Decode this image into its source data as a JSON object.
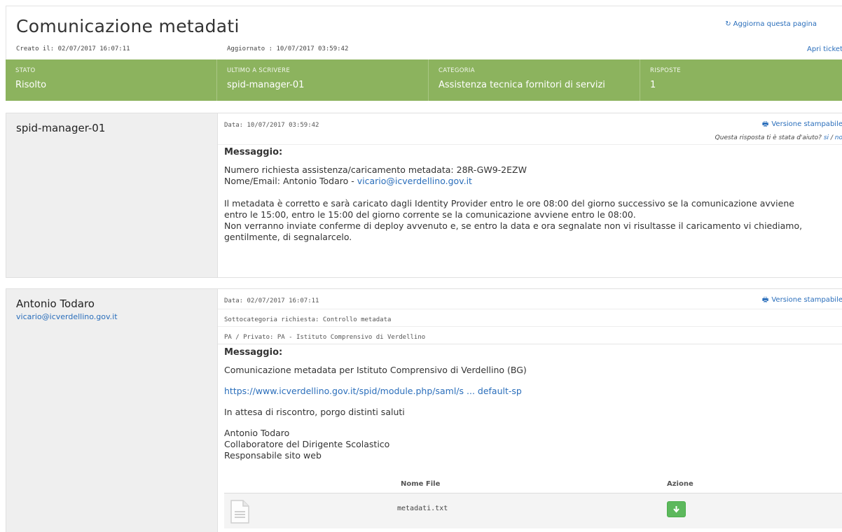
{
  "header": {
    "title": "Comunicazione metadati",
    "created": "Creato il: 02/07/2017 16:07:11",
    "updated": "Aggiornato : 10/07/2017 03:59:42",
    "refresh_label": "Aggiorna questa pagina",
    "open_ticket_label": "Apri ticket"
  },
  "status_bar": {
    "color": "#8cb35e",
    "cells": [
      {
        "label": "STATO",
        "value": "Risolto"
      },
      {
        "label": "ULTIMO A SCRIVERE",
        "value": "spid-manager-01"
      },
      {
        "label": "CATEGORIA",
        "value": "Assistenza tecnica fornitori di servizi"
      },
      {
        "label": "RISPOSTE",
        "value": "1"
      }
    ]
  },
  "messages": [
    {
      "author": "spid-manager-01",
      "date": "Data: 10/07/2017 03:59:42",
      "print_label": "Versione stampabile",
      "helpful_question": "Questa risposta ti è stata d'aiuto?",
      "helpful_yes": "si",
      "helpful_sep": " / ",
      "helpful_no": "no",
      "heading": "Messaggio:",
      "lines": {
        "request_prefix": "Numero richiesta assistenza/caricamento metadata: 28R-GW9-2EZW",
        "name_prefix": "Nome/Email: Antonio Todaro - ",
        "email": "vicario@icverdellino.gov.it",
        "p1": "Il metadata è corretto e sarà caricato dagli Identity Provider entro le ore 08:00 del giorno successivo se la comunicazione avviene",
        "p2": "entro le 15:00, entro le 15:00 del giorno corrente se la comunicazione avviene entro le 08:00.",
        "p3": "Non verranno inviate conferme di deploy avvenuto e, se entro la data e ora segnalate non vi risultasse il caricamento vi chiediamo,",
        "p4": "gentilmente, di segnalarcelo."
      }
    },
    {
      "author": "Antonio Todaro",
      "author_email": "vicario@icverdellino.gov.it",
      "date": "Data: 02/07/2017 16:07:11",
      "subcategory": "Sottocategoria richiesta: Controllo metadata",
      "pa_private": "PA / Privato: PA - Istituto Comprensivo di Verdellino",
      "print_label": "Versione stampabile",
      "heading": "Messaggio:",
      "lines": {
        "intro": "Comunicazione metadata per Istituto Comprensivo di Verdellino (BG)",
        "url": "https://www.icverdellino.gov.it/spid/module.php/saml/s ... default-sp",
        "closing": "In attesa di riscontro, porgo distinti saluti",
        "sig1": "Antonio Todaro",
        "sig2": "Collaboratore del Dirigente Scolastico",
        "sig3": "Responsabile sito web"
      },
      "attachments": {
        "col_name": "Nome File",
        "col_action": "Azione",
        "files": [
          {
            "name": "metadati.txt",
            "icon": "file-text-icon",
            "action_icon": "download-arrow-icon"
          }
        ]
      }
    }
  ]
}
